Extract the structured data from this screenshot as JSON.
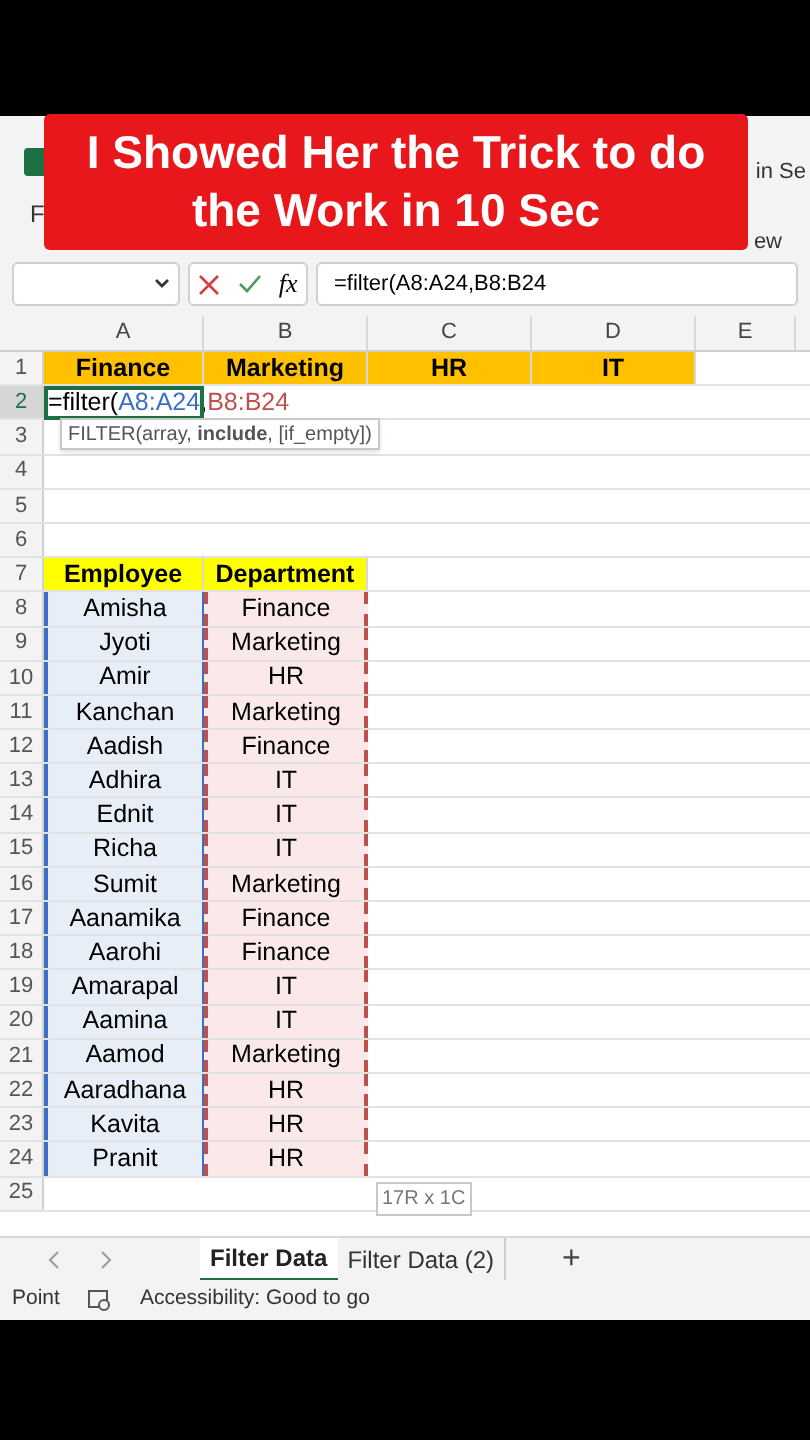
{
  "banner": {
    "title": "I Showed Her the Trick to do the Work in 10 Sec"
  },
  "ribbon": {
    "left_label": "F",
    "right_labels": [
      "in Se",
      "ew"
    ]
  },
  "formula_bar": {
    "formula": "=filter(A8:A24,B8:B24",
    "fx": "fx"
  },
  "columns": [
    "A",
    "B",
    "C",
    "D",
    "E"
  ],
  "rows": [
    {
      "number": "1",
      "cells": [
        {
          "text": "Finance",
          "kind": "header"
        },
        {
          "text": "Marketing",
          "kind": "header"
        },
        {
          "text": "HR",
          "kind": "header"
        },
        {
          "text": "IT",
          "kind": "header"
        }
      ]
    },
    {
      "number": "2",
      "selected": true,
      "formula_parts": [
        {
          "text": "=filter(",
          "kind": "plain"
        },
        {
          "text": "A8:A24",
          "kind": "ref1"
        },
        {
          "text": ",",
          "kind": "plain"
        },
        {
          "text": "B8:B24",
          "kind": "ref2"
        }
      ]
    },
    {
      "number": "3",
      "hint": "FILTER(array, **include**, [if_empty])"
    },
    {
      "number": "4"
    },
    {
      "number": "5"
    },
    {
      "number": "6"
    },
    {
      "number": "7",
      "cells": [
        {
          "text": "Employee",
          "kind": "table-header"
        },
        {
          "text": "Department",
          "kind": "table-header"
        }
      ]
    },
    {
      "number": "8",
      "cells": [
        {
          "text": "Amisha",
          "kind": "ref1"
        },
        {
          "text": "Finance",
          "kind": "ref2"
        }
      ]
    },
    {
      "number": "9",
      "cells": [
        {
          "text": "Jyoti",
          "kind": "ref1"
        },
        {
          "text": "Marketing",
          "kind": "ref2"
        }
      ]
    },
    {
      "number": "10",
      "cells": [
        {
          "text": "Amir",
          "kind": "ref1"
        },
        {
          "text": "HR",
          "kind": "ref2"
        }
      ]
    },
    {
      "number": "11",
      "cells": [
        {
          "text": "Kanchan",
          "kind": "ref1"
        },
        {
          "text": "Marketing",
          "kind": "ref2"
        }
      ]
    },
    {
      "number": "12",
      "cells": [
        {
          "text": "Aadish",
          "kind": "ref1"
        },
        {
          "text": "Finance",
          "kind": "ref2"
        }
      ]
    },
    {
      "number": "13",
      "cells": [
        {
          "text": "Adhira",
          "kind": "ref1"
        },
        {
          "text": "IT",
          "kind": "ref2"
        }
      ]
    },
    {
      "number": "14",
      "cells": [
        {
          "text": "Ednit",
          "kind": "ref1"
        },
        {
          "text": "IT",
          "kind": "ref2"
        }
      ]
    },
    {
      "number": "15",
      "cells": [
        {
          "text": "Richa",
          "kind": "ref1"
        },
        {
          "text": "IT",
          "kind": "ref2"
        }
      ]
    },
    {
      "number": "16",
      "cells": [
        {
          "text": "Sumit",
          "kind": "ref1"
        },
        {
          "text": "Marketing",
          "kind": "ref2"
        }
      ]
    },
    {
      "number": "17",
      "cells": [
        {
          "text": "Aanamika",
          "kind": "ref1"
        },
        {
          "text": "Finance",
          "kind": "ref2"
        }
      ]
    },
    {
      "number": "18",
      "cells": [
        {
          "text": "Aarohi",
          "kind": "ref1"
        },
        {
          "text": "Finance",
          "kind": "ref2"
        }
      ]
    },
    {
      "number": "19",
      "cells": [
        {
          "text": "Amarapal",
          "kind": "ref1"
        },
        {
          "text": "IT",
          "kind": "ref2"
        }
      ]
    },
    {
      "number": "20",
      "cells": [
        {
          "text": "Aamina",
          "kind": "ref1"
        },
        {
          "text": "IT",
          "kind": "ref2"
        }
      ]
    },
    {
      "number": "21",
      "cells": [
        {
          "text": "Aamod",
          "kind": "ref1"
        },
        {
          "text": "Marketing",
          "kind": "ref2"
        }
      ]
    },
    {
      "number": "22",
      "cells": [
        {
          "text": "Aaradhana",
          "kind": "ref1"
        },
        {
          "text": "HR",
          "kind": "ref2"
        }
      ]
    },
    {
      "number": "23",
      "cells": [
        {
          "text": "Kavita",
          "kind": "ref1"
        },
        {
          "text": "HR",
          "kind": "ref2"
        }
      ]
    },
    {
      "number": "24",
      "cells": [
        {
          "text": "Pranit",
          "kind": "ref1"
        },
        {
          "text": "HR",
          "kind": "ref2"
        }
      ]
    },
    {
      "number": "25",
      "size_hint": "17R x 1C"
    }
  ],
  "sheet_tabs": [
    {
      "label": "Filter Data",
      "selected": true
    },
    {
      "label": "Filter Data (2)",
      "selected": false
    }
  ],
  "add_sheet": "+",
  "status_bar": {
    "mode": "Point",
    "accessibility": "Accessibility: Good to go"
  }
}
